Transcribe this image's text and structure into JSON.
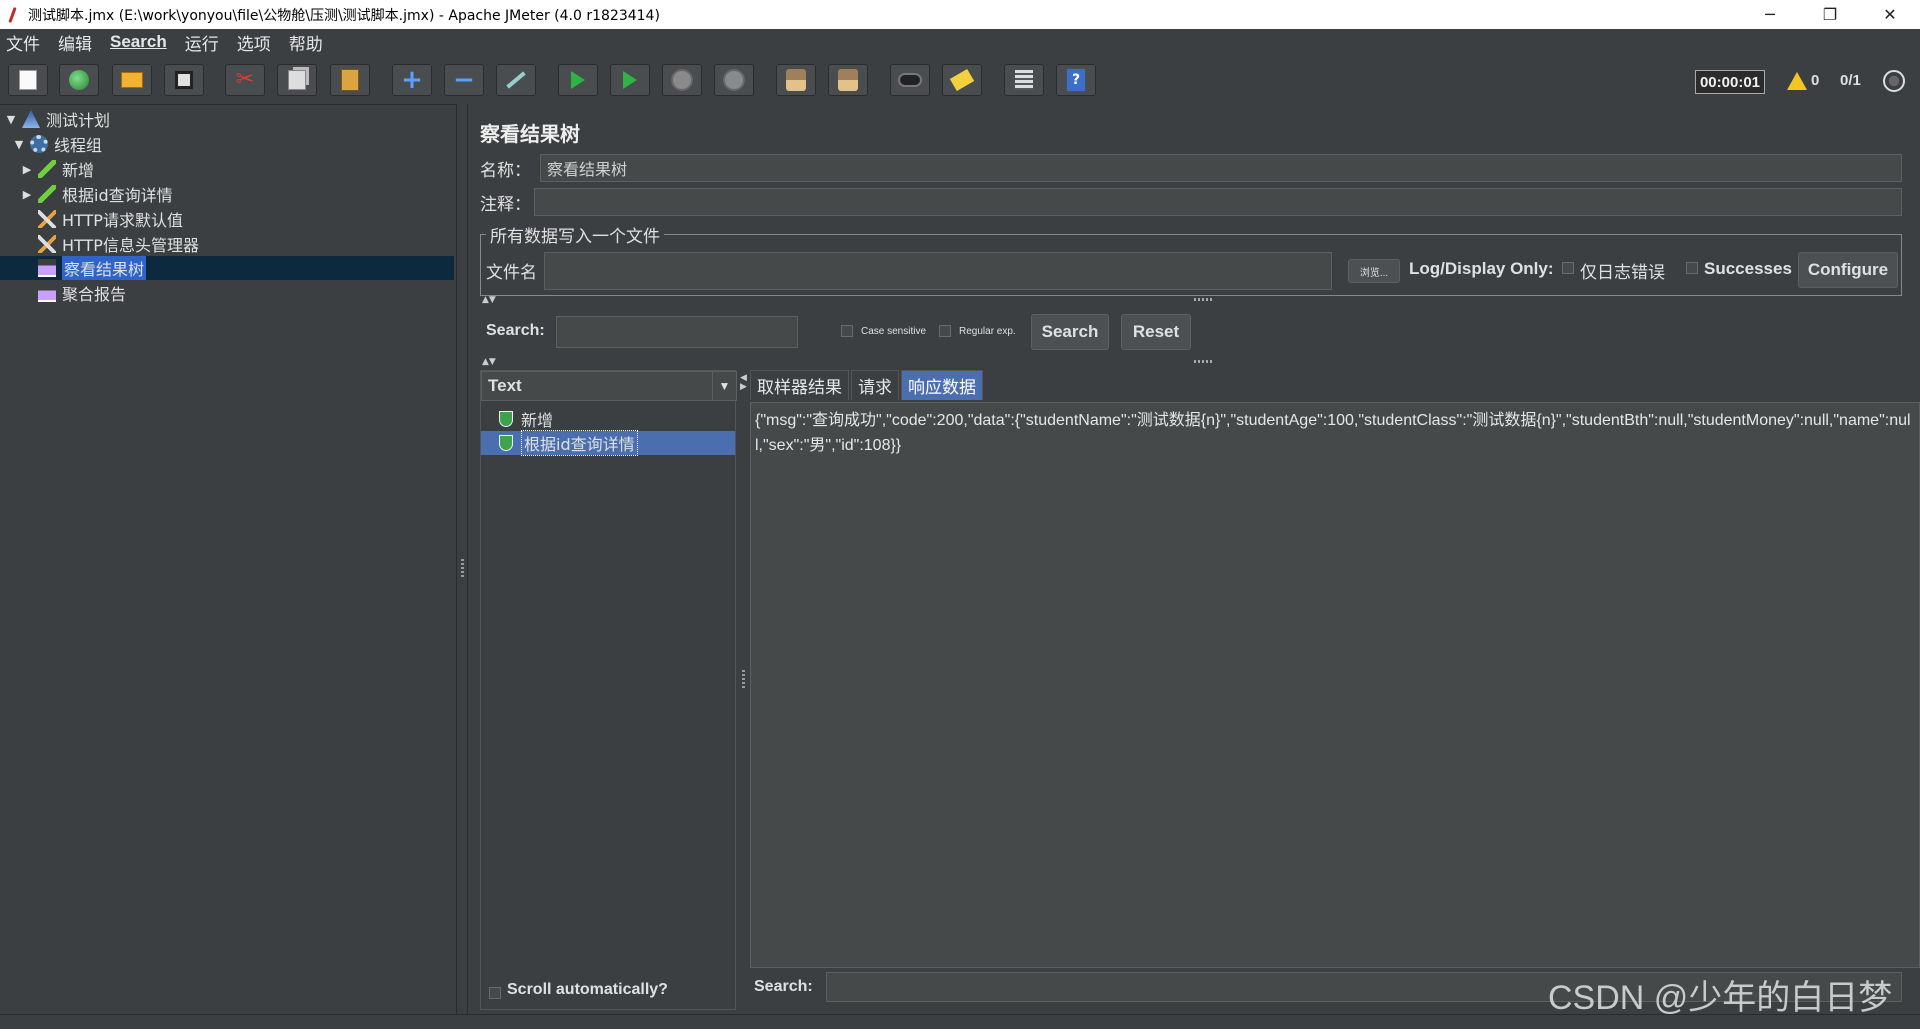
{
  "window": {
    "title": "测试脚本.jmx (E:\\work\\yonyou\\file\\公物舱\\压测\\测试脚本.jmx) - Apache JMeter (4.0 r1823414)",
    "minimize": "─",
    "maximize": "❐",
    "close": "✕"
  },
  "menu": {
    "items": [
      "文件",
      "编辑",
      "Search",
      "运行",
      "选项",
      "帮助"
    ]
  },
  "toolbar": {
    "buttons": [
      "new-icon",
      "templates-icon",
      "open-icon",
      "save-icon",
      "cut-icon",
      "copy-icon",
      "paste-icon",
      "expand-icon",
      "collapse-icon",
      "toggle-icon",
      "start-icon",
      "start-no-pauses-icon",
      "stop-icon",
      "shutdown-icon",
      "clear-icon",
      "clear-all-icon",
      "search-icon",
      "reset-search-icon",
      "function-helper-icon",
      "help-icon"
    ],
    "plus": "+",
    "minus": "−",
    "help": "?",
    "timer": "00:00:01",
    "warnings": "0",
    "threads": "0/1"
  },
  "tree": {
    "items": [
      {
        "label": "测试计划",
        "icon": "test-plan-icon"
      },
      {
        "label": "线程组",
        "icon": "thread-group-icon"
      },
      {
        "label": "新增",
        "icon": "http-sampler-icon"
      },
      {
        "label": "根据id查询详情",
        "icon": "http-sampler-icon"
      },
      {
        "label": "HTTP请求默认值",
        "icon": "config-element-icon"
      },
      {
        "label": "HTTP信息头管理器",
        "icon": "config-element-icon"
      },
      {
        "label": "察看结果树",
        "icon": "listener-icon"
      },
      {
        "label": "聚合报告",
        "icon": "listener-icon"
      }
    ]
  },
  "panel": {
    "title": "察看结果树",
    "name_label": "名称：",
    "name_value": "察看结果树",
    "comment_label": "注释：",
    "comment_value": "",
    "file_section_title": "所有数据写入一个文件",
    "filename_label": "文件名",
    "filename_value": "",
    "browse_label": "浏览...",
    "log_display_label": "Log/Display Only:",
    "errors_only_label": "仅日志错误",
    "successes_label": "Successes",
    "configure_label": "Configure"
  },
  "search": {
    "label": "Search:",
    "value": "",
    "case_sensitive_label": "Case sensitive",
    "regex_label": "Regular exp.",
    "search_button": "Search",
    "reset_button": "Reset"
  },
  "results": {
    "renderer": "Text",
    "samples": [
      "新增",
      "根据id查询详情"
    ],
    "scroll_auto_label": "Scroll automatically?"
  },
  "tabs": [
    "取样器结果",
    "请求",
    "响应数据"
  ],
  "response": {
    "body": "{\"msg\":\"查询成功\",\"code\":200,\"data\":{\"studentName\":\"测试数据{n}\",\"studentAge\":100,\"studentClass\":\"测试数据{n}\",\"studentBth\":null,\"studentMoney\":null,\"name\":null,\"sex\":\"男\",\"id\":108}}",
    "search_label": "Search:",
    "search_value": ""
  },
  "watermark": "CSDN @少年的白日梦"
}
